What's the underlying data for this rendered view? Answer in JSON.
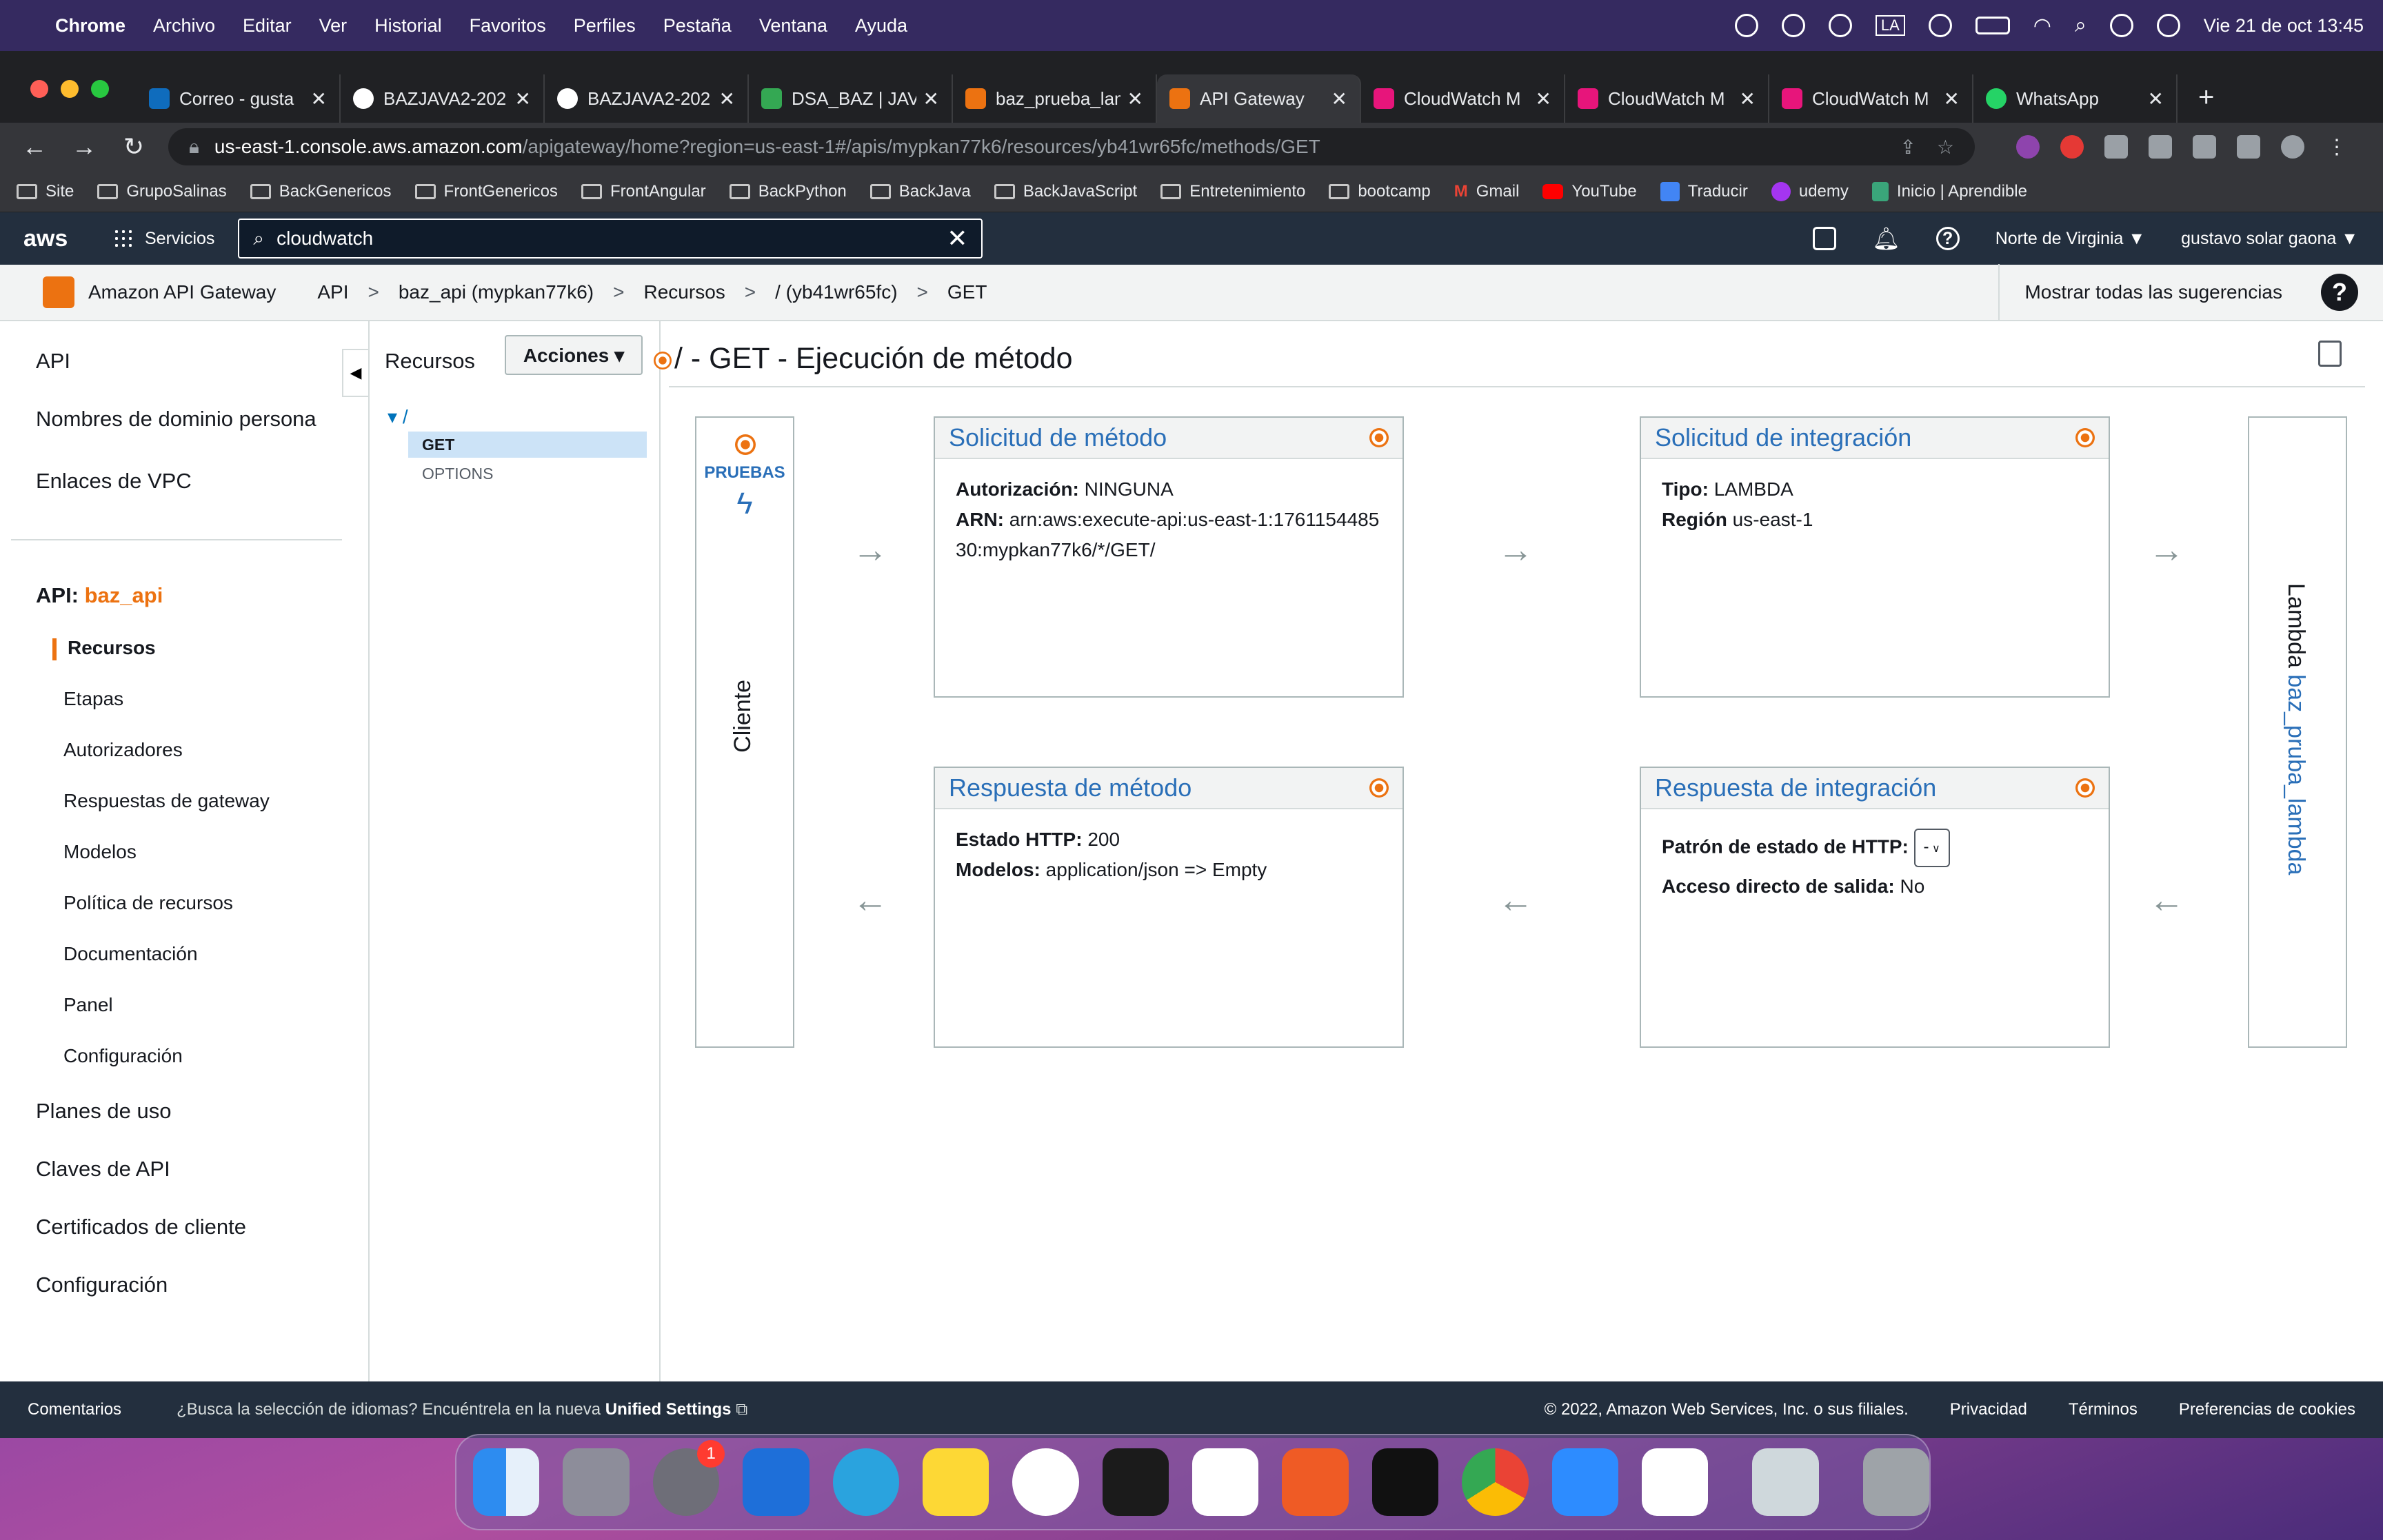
{
  "menubar": {
    "app": "Chrome",
    "items": [
      "Archivo",
      "Editar",
      "Ver",
      "Historial",
      "Favoritos",
      "Perfiles",
      "Pestaña",
      "Ventana",
      "Ayuda"
    ],
    "clock": "Vie 21 de oct  13:45",
    "la": "LA"
  },
  "tabs": [
    {
      "label": "Correo - gusta",
      "color": "#0f6cbd"
    },
    {
      "label": "BAZJAVA2-202",
      "color": "#ffffff"
    },
    {
      "label": "BAZJAVA2-202",
      "color": "#ffffff"
    },
    {
      "label": "DSA_BAZ | JAV",
      "color": "#34a853"
    },
    {
      "label": "baz_prueba_lam",
      "color": "#ec7211"
    },
    {
      "label": "API Gateway",
      "color": "#ec7211"
    },
    {
      "label": "CloudWatch M",
      "color": "#e7157b"
    },
    {
      "label": "CloudWatch M",
      "color": "#e7157b"
    },
    {
      "label": "CloudWatch M",
      "color": "#e7157b"
    },
    {
      "label": "WhatsApp",
      "color": "#25d366"
    }
  ],
  "url": {
    "host": "us-east-1.console.aws.amazon.com",
    "path": "/apigateway/home?region=us-east-1#/apis/mypkan77k6/resources/yb41wr65fc/methods/GET"
  },
  "bookmarks": [
    "Site",
    "GrupoSalinas",
    "BackGenericos",
    "FrontGenericos",
    "FrontAngular",
    "BackPython",
    "BackJava",
    "BackJavaScript",
    "Entretenimiento",
    "bootcamp",
    "Gmail",
    "YouTube",
    "Traducir",
    "udemy",
    "Inicio | Aprendible"
  ],
  "aws": {
    "logo": "aws",
    "services": "Servicios",
    "search": "cloudwatch",
    "region": "Norte de Virginia ▼",
    "user": "gustavo solar gaona ▼"
  },
  "crumbs": {
    "service": "Amazon API Gateway",
    "items": [
      "API",
      "baz_api (mypkan77k6)",
      "Recursos",
      "/ (yb41wr65fc)",
      "GET"
    ],
    "suggest": "Mostrar todas las sugerencias"
  },
  "nav": {
    "api": "API",
    "domains": "Nombres de dominio persona",
    "vpc": "Enlaces de VPC",
    "api_label": "API:",
    "api_name": "baz_api",
    "resources": "Recursos",
    "stages": "Etapas",
    "authorizers": "Autorizadores",
    "gw_responses": "Respuestas de gateway",
    "models": "Modelos",
    "policy": "Política de recursos",
    "docs": "Documentación",
    "dashboard": "Panel",
    "config": "Configuración",
    "usage": "Planes de uso",
    "keys": "Claves de API",
    "certs": "Certificados de cliente",
    "settings": "Configuración"
  },
  "resources": {
    "header": "Recursos",
    "actions": "Acciones ▾",
    "root": "▾  /",
    "get": "GET",
    "options": "OPTIONS"
  },
  "main": {
    "title": "/ - GET - Ejecución de método",
    "client": {
      "tests": "PRUEBAS",
      "bolt": "ϟ",
      "label": "Cliente"
    },
    "method_request": {
      "title": "Solicitud de método",
      "auth_label": "Autorización:",
      "auth": "NINGUNA",
      "arn_label": "ARN:",
      "arn": "arn:aws:execute-api:us-east-1:176115448530:mypkan77k6/*/GET/"
    },
    "integration_request": {
      "title": "Solicitud de integración",
      "type_label": "Tipo:",
      "type": "LAMBDA",
      "region_label": "Región",
      "region": "us-east-1"
    },
    "method_response": {
      "title": "Respuesta de método",
      "status_label": "Estado HTTP:",
      "status": "200",
      "models_label": "Modelos:",
      "models": "application/json => Empty"
    },
    "integration_response": {
      "title": "Respuesta de integración",
      "pattern_label": "Patrón de estado de HTTP:",
      "pattern": "-",
      "passthrough_label": "Acceso directo de salida:",
      "passthrough": "No"
    },
    "lambda": {
      "prefix": "Lambda ",
      "name": "baz_pruba_lambda"
    }
  },
  "footer": {
    "feedback": "Comentarios",
    "lang": "¿Busca la selección de idiomas? Encuéntrela en la nueva",
    "unified": "Unified Settings",
    "copyright": "© 2022, Amazon Web Services, Inc. o sus filiales.",
    "privacy": "Privacidad",
    "terms": "Términos",
    "cookies": "Preferencias de cookies"
  },
  "dock": {
    "badge": "1"
  }
}
